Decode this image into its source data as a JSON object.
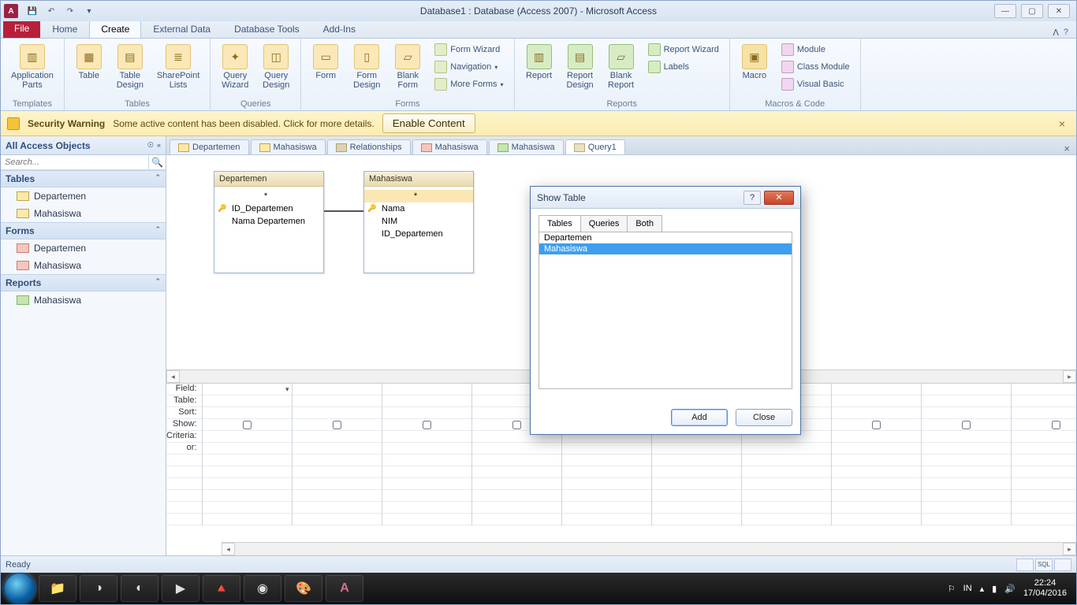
{
  "title": "Database1 : Database (Access 2007)  -  Microsoft Access",
  "app_letter": "A",
  "ribbon_tabs": {
    "file": "File",
    "home": "Home",
    "create": "Create",
    "external": "External Data",
    "dbtools": "Database Tools",
    "addins": "Add-Ins"
  },
  "ribbon": {
    "templates": {
      "label": "Templates",
      "app_parts": "Application\nParts"
    },
    "tables": {
      "label": "Tables",
      "table": "Table",
      "table_design": "Table\nDesign",
      "sp_lists": "SharePoint\nLists"
    },
    "queries": {
      "label": "Queries",
      "qwizard": "Query\nWizard",
      "qdesign": "Query\nDesign"
    },
    "forms": {
      "label": "Forms",
      "form": "Form",
      "form_design": "Form\nDesign",
      "blank_form": "Blank\nForm",
      "form_wizard": "Form Wizard",
      "navigation": "Navigation",
      "more_forms": "More Forms"
    },
    "reports": {
      "label": "Reports",
      "report": "Report",
      "report_design": "Report\nDesign",
      "blank_report": "Blank\nReport",
      "report_wizard": "Report Wizard",
      "labels": "Labels"
    },
    "macros": {
      "label": "Macros & Code",
      "macro": "Macro",
      "module": "Module",
      "class_module": "Class Module",
      "visual_basic": "Visual Basic"
    }
  },
  "security": {
    "title": "Security Warning",
    "msg": "Some active content has been disabled. Click for more details.",
    "enable": "Enable Content"
  },
  "nav": {
    "title": "All Access Objects",
    "search_placeholder": "Search...",
    "cats": {
      "tables": "Tables",
      "forms": "Forms",
      "reports": "Reports"
    },
    "tables": [
      "Departemen",
      "Mahasiswa"
    ],
    "forms": [
      "Departemen",
      "Mahasiswa"
    ],
    "reports": [
      "Mahasiswa"
    ]
  },
  "doctabs": [
    "Departemen",
    "Mahasiswa",
    "Relationships",
    "Mahasiswa",
    "Mahasiswa",
    "Query1"
  ],
  "query": {
    "tables": {
      "dep": {
        "title": "Departemen",
        "fields": [
          "*",
          "ID_Departemen",
          "Nama Departemen"
        ]
      },
      "mah": {
        "title": "Mahasiswa",
        "fields": [
          "*",
          "Nama",
          "NIM",
          "ID_Departemen"
        ]
      }
    },
    "grid_labels": {
      "field": "Field:",
      "table": "Table:",
      "sort": "Sort:",
      "show": "Show:",
      "criteria": "Criteria:",
      "or": "or:"
    }
  },
  "dialog": {
    "title": "Show Table",
    "tabs": {
      "tables": "Tables",
      "queries": "Queries",
      "both": "Both"
    },
    "items": [
      "Departemen",
      "Mahasiswa"
    ],
    "selected_index": 1,
    "add": "Add",
    "close": "Close"
  },
  "status": {
    "ready": "Ready",
    "sql": "SQL"
  },
  "taskbar": {
    "lang": "IN",
    "time": "22:24",
    "date": "17/04/2016"
  }
}
